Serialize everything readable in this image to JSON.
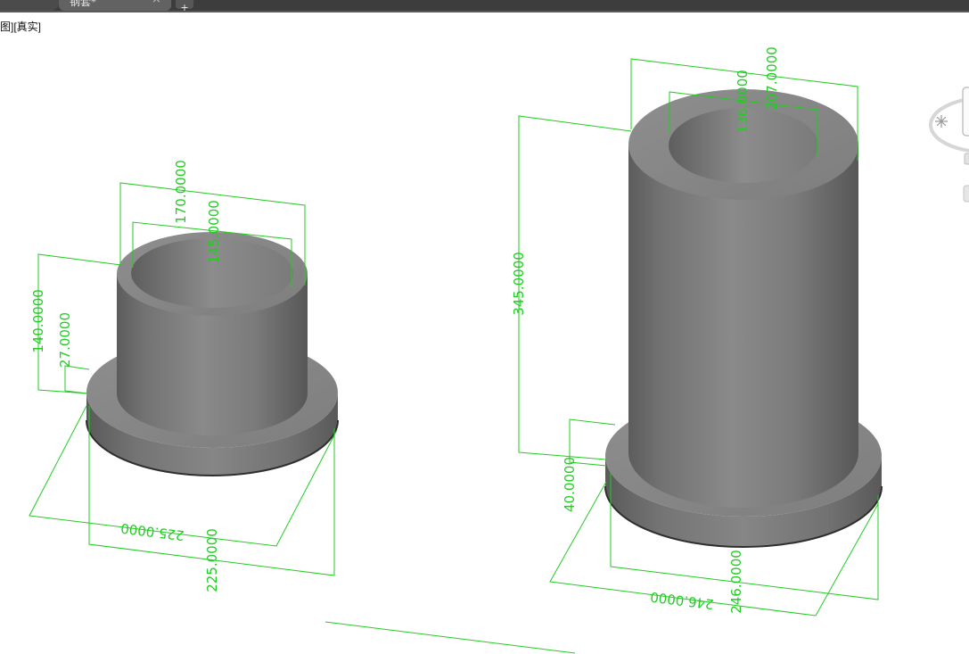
{
  "tabs": {
    "active": {
      "label": "钢套*",
      "close_glyph": "×"
    },
    "new_tab_glyph": "+"
  },
  "viewport": {
    "label": "图][真实]"
  },
  "left_bushing": {
    "dim_top_outer": "170.0000",
    "dim_top_inner": "145.0000",
    "dim_height": "140.0000",
    "dim_flange_height": "27.0000",
    "dim_flange_front": "225.0000",
    "dim_flange_side": "225.0000"
  },
  "right_bushing": {
    "dim_top_outer": "207.0000",
    "dim_top_inner": "136.0000",
    "dim_height": "345.0000",
    "dim_flange_height": "40.0000",
    "dim_flange_front": "246.0000",
    "dim_flange_side": "246.0000"
  },
  "icons": {
    "tab_close": "close-icon",
    "new_tab": "plus-icon",
    "viewcube": "compass-icon"
  },
  "colors": {
    "dimension_line": "#22cc22",
    "model_gray": "#7d7d7d",
    "tab_bar": "#3d3d3d",
    "background": "#ffffff"
  }
}
